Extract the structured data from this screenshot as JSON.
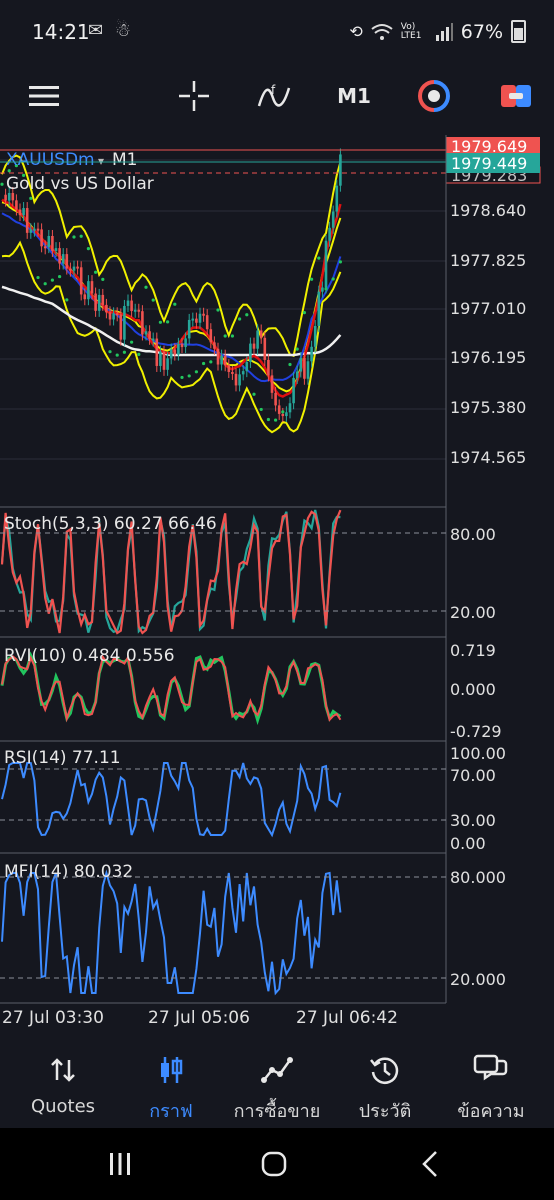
{
  "status_bar": {
    "time": "14:21",
    "left_icons": [
      "gmail-icon",
      "app-notification-icon"
    ],
    "right_text": "Vo) LTE1",
    "battery": "67%"
  },
  "toolbar": {
    "items": [
      "menu-icon",
      "crosshair-icon",
      "indicators-icon",
      "timeframe",
      "trade-sync-icon",
      "one-click-trade-icon"
    ],
    "timeframe": "M1"
  },
  "chart": {
    "symbol": "XAUUSDm",
    "timeframe": "M1",
    "description": "Gold vs US Dollar",
    "price_labels": [
      "1978.640",
      "1977.825",
      "1977.010",
      "1976.195",
      "1975.380",
      "1974.565"
    ],
    "ask_price": "1979.649",
    "bid_price": "1979.449",
    "faded_price": "1979.283",
    "colors": {
      "background": "#15171f",
      "bullish": "#26a69a",
      "bearish": "#ef5350",
      "bollinger": "#f0f000",
      "sma_white": "#f0f0f0",
      "sma_red": "#e01010",
      "sma_blue": "#2040e0",
      "psar": "#22c55e",
      "rsi_line": "#3d8bff",
      "ask_line": "#ef5350",
      "bid_line": "#26a69a"
    },
    "stoch": {
      "label": "Stoch(5,3,3) 60.27 66.46",
      "levels": [
        "80.00",
        "20.00"
      ]
    },
    "rvi": {
      "label": "RVI(10) 0.484 0.556",
      "levels": [
        "0.719",
        "0.000",
        "-0.729"
      ]
    },
    "rsi": {
      "label": "RSI(14) 77.11",
      "levels": [
        "100.00",
        "70.00",
        "30.00",
        "0.00"
      ]
    },
    "mfi": {
      "label": "MFI(14) 80.032",
      "levels": [
        "80.000",
        "20.000"
      ]
    },
    "time_labels": [
      "27 Jul 03:30",
      "27 Jul 05:06",
      "27 Jul 06:42"
    ]
  },
  "bottom_nav": {
    "items": [
      {
        "label": "Quotes",
        "icon": "quotes-arrows-icon"
      },
      {
        "label": "กราฟ",
        "icon": "candlestick-chart-icon",
        "active": true
      },
      {
        "label": "การซื้อขาย",
        "icon": "trade-line-icon"
      },
      {
        "label": "ประวัติ",
        "icon": "history-clock-icon"
      },
      {
        "label": "ข้อความ",
        "icon": "messages-chat-icon"
      }
    ]
  },
  "system_nav": [
    "recent-apps-icon",
    "home-icon",
    "back-icon"
  ]
}
